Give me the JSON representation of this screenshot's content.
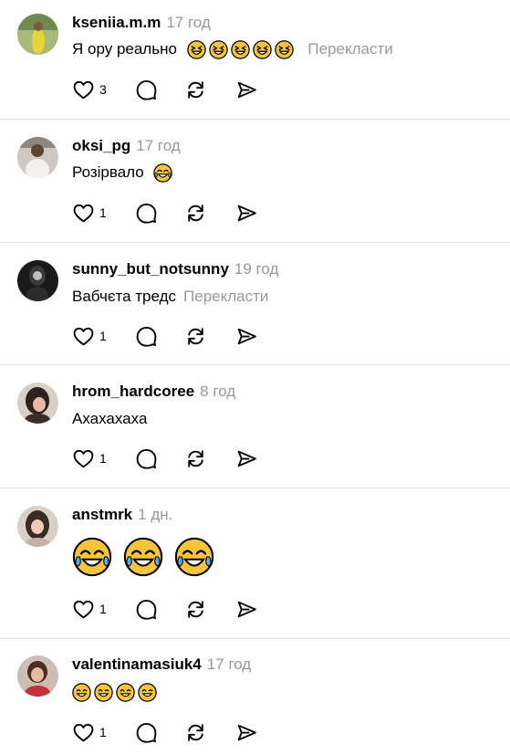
{
  "icons": {
    "like": "heart-icon",
    "reply": "comment-bubble-icon",
    "repost": "repost-arrows-icon",
    "share": "send-paper-plane-icon"
  },
  "colors": {
    "text": "#000000",
    "muted": "#999999",
    "divider": "#e2e2e2",
    "emoji_face": "#f8c43a"
  },
  "comments": [
    {
      "username": "kseniia.m.m",
      "time": "17 год",
      "text": "Я ору реально",
      "emojis": [
        "grinning-squinting-face",
        "grinning-squinting-face",
        "grinning-squinting-face",
        "grinning-squinting-face",
        "grinning-squinting-face"
      ],
      "translate": "Перекласти",
      "likes": "3"
    },
    {
      "username": "oksi_pg",
      "time": "17 год",
      "text": "Розірвало",
      "emojis": [
        "face-with-tears-of-joy"
      ],
      "translate": "",
      "likes": "1"
    },
    {
      "username": "sunny_but_notsunny",
      "time": "19 год",
      "text": "Вабчєта тредс",
      "emojis": [],
      "translate": "Перекласти",
      "likes": "1"
    },
    {
      "username": "hrom_hardcoree",
      "time": "8 год",
      "text": "Ахахахаха",
      "emojis": [],
      "translate": "",
      "likes": "1"
    },
    {
      "username": "anstmrk",
      "time": "1 дн.",
      "text": "",
      "emojis": [
        "face-with-tears-of-joy",
        "face-with-tears-of-joy",
        "face-with-tears-of-joy"
      ],
      "translate": "",
      "likes": "1"
    },
    {
      "username": "valentinamasiuk4",
      "time": "17 год",
      "text": "",
      "emojis": [
        "grinning-face-with-smiling-eyes",
        "grinning-face-with-smiling-eyes",
        "grinning-face-with-smiling-eyes",
        "grinning-face-with-smiling-eyes"
      ],
      "translate": "",
      "likes": "1"
    }
  ]
}
